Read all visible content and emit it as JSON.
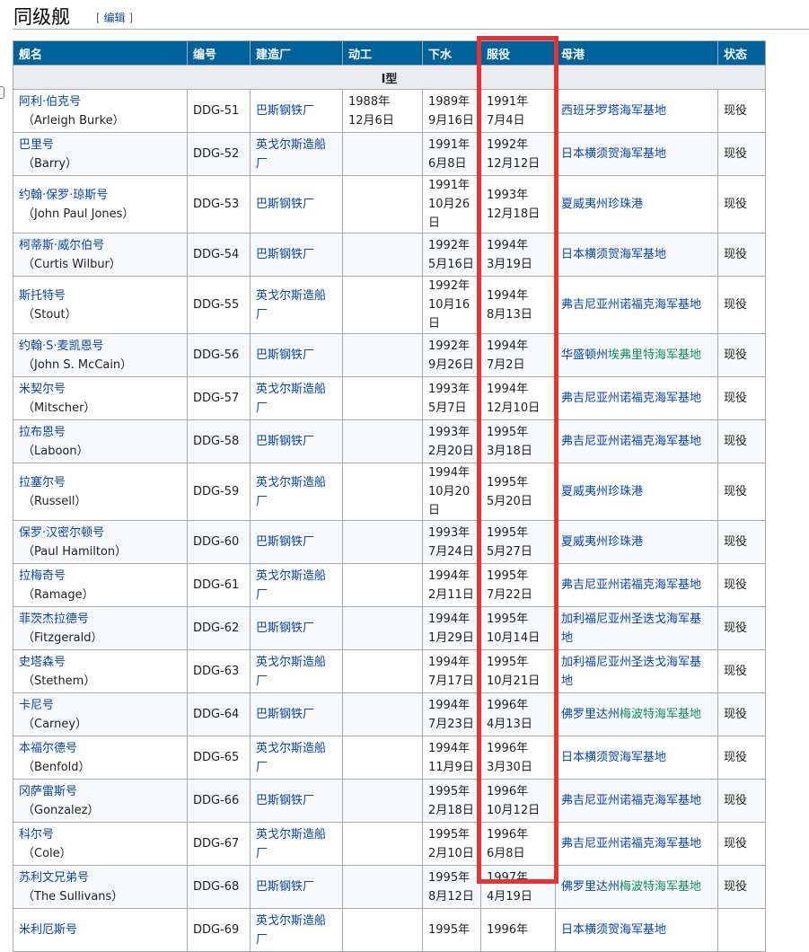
{
  "section": {
    "title": "同级舰",
    "edit_open": "[ ",
    "edit_label": "编辑",
    "edit_close": " ]"
  },
  "table": {
    "columns": [
      "舰名",
      "编号",
      "建造厂",
      "动工",
      "下水",
      "服役",
      "母港",
      "状态"
    ],
    "subheader": "I型",
    "rows": [
      {
        "cn": "阿利·伯克号",
        "en": "（Arleigh Burke）",
        "no": "DDG-51",
        "yard": "巴斯钢铁厂",
        "laid_y": "1988年",
        "laid_d": "12月6日",
        "launch_y": "1989年",
        "launch_d": "9月16日",
        "comm_y": "1991年",
        "comm_d": "7月4日",
        "port_a": "西班牙罗塔海军基地",
        "port_b": "",
        "status": "现役"
      },
      {
        "cn": "巴里号",
        "en": "（Barry）",
        "no": "DDG-52",
        "yard": "英戈尔斯造船厂",
        "laid_y": "",
        "laid_d": "",
        "launch_y": "1991年",
        "launch_d": "6月8日",
        "comm_y": "1992年",
        "comm_d": "12月12日",
        "port_a": "日本横须贺海军基地",
        "port_b": "",
        "status": "现役"
      },
      {
        "cn": "约翰·保罗·琼斯号",
        "en": "（John Paul Jones）",
        "no": "DDG-53",
        "yard": "巴斯钢铁厂",
        "laid_y": "",
        "laid_d": "",
        "launch_y": "1991年",
        "launch_d": "10月26日",
        "comm_y": "1993年",
        "comm_d": "12月18日",
        "port_a": "夏威夷州珍珠港",
        "port_b": "",
        "status": "现役"
      },
      {
        "cn": "柯蒂斯·威尔伯号",
        "en": "（Curtis Wilbur）",
        "no": "DDG-54",
        "yard": "巴斯钢铁厂",
        "laid_y": "",
        "laid_d": "",
        "launch_y": "1992年",
        "launch_d": "5月16日",
        "comm_y": "1994年",
        "comm_d": "3月19日",
        "port_a": "日本横须贺海军基地",
        "port_b": "",
        "status": "现役"
      },
      {
        "cn": "斯托特号",
        "en": "（Stout）",
        "no": "DDG-55",
        "yard": "英戈尔斯造船厂",
        "laid_y": "",
        "laid_d": "",
        "launch_y": "1992年",
        "launch_d": "10月16日",
        "comm_y": "1994年",
        "comm_d": "8月13日",
        "port_a": "弗吉尼亚州诺福克海军基地",
        "port_b": "",
        "status": "现役"
      },
      {
        "cn": "约翰·S·麦凯恩号",
        "en": "（John S. McCain）",
        "no": "DDG-56",
        "yard": "巴斯钢铁厂",
        "laid_y": "",
        "laid_d": "",
        "launch_y": "1992年",
        "launch_d": "9月26日",
        "comm_y": "1994年",
        "comm_d": "7月2日",
        "port_a": "华盛顿州",
        "port_b": "埃弗里特海军基地",
        "status": "现役"
      },
      {
        "cn": "米契尔号",
        "en": "（Mitscher）",
        "no": "DDG-57",
        "yard": "英戈尔斯造船厂",
        "laid_y": "",
        "laid_d": "",
        "launch_y": "1993年",
        "launch_d": "5月7日",
        "comm_y": "1994年",
        "comm_d": "12月10日",
        "port_a": "弗吉尼亚州诺福克海军基地",
        "port_b": "",
        "status": "现役"
      },
      {
        "cn": "拉布恩号",
        "en": "（Laboon）",
        "no": "DDG-58",
        "yard": "巴斯钢铁厂",
        "laid_y": "",
        "laid_d": "",
        "launch_y": "1993年",
        "launch_d": "2月20日",
        "comm_y": "1995年",
        "comm_d": "3月18日",
        "port_a": "弗吉尼亚州诺福克海军基地",
        "port_b": "",
        "status": "现役"
      },
      {
        "cn": "拉塞尔号",
        "en": "（Russell）",
        "no": "DDG-59",
        "yard": "英戈尔斯造船厂",
        "laid_y": "",
        "laid_d": "",
        "launch_y": "1994年",
        "launch_d": "10月20日",
        "comm_y": "1995年",
        "comm_d": "5月20日",
        "port_a": "夏威夷州珍珠港",
        "port_b": "",
        "status": "现役"
      },
      {
        "cn": "保罗·汉密尔顿号",
        "en": "（Paul Hamilton）",
        "no": "DDG-60",
        "yard": "巴斯钢铁厂",
        "laid_y": "",
        "laid_d": "",
        "launch_y": "1993年",
        "launch_d": "7月24日",
        "comm_y": "1995年",
        "comm_d": "5月27日",
        "port_a": "夏威夷州珍珠港",
        "port_b": "",
        "status": "现役"
      },
      {
        "cn": "拉梅奇号",
        "en": "（Ramage）",
        "no": "DDG-61",
        "yard": "英戈尔斯造船厂",
        "laid_y": "",
        "laid_d": "",
        "launch_y": "1994年",
        "launch_d": "2月11日",
        "comm_y": "1995年",
        "comm_d": "7月22日",
        "port_a": "弗吉尼亚州诺福克海军基地",
        "port_b": "",
        "status": "现役"
      },
      {
        "cn": "菲茨杰拉德号",
        "en": "（Fitzgerald）",
        "no": "DDG-62",
        "yard": "巴斯钢铁厂",
        "laid_y": "",
        "laid_d": "",
        "launch_y": "1994年",
        "launch_d": "1月29日",
        "comm_y": "1995年",
        "comm_d": "10月14日",
        "port_a": "加利福尼亚州圣迭戈海军基地",
        "port_b": "",
        "status": "现役"
      },
      {
        "cn": "史塔森号",
        "en": "（Stethem）",
        "no": "DDG-63",
        "yard": "英戈尔斯造船厂",
        "laid_y": "",
        "laid_d": "",
        "launch_y": "1994年",
        "launch_d": "7月17日",
        "comm_y": "1995年",
        "comm_d": "10月21日",
        "port_a": "加利福尼亚州圣迭戈海军基地",
        "port_b": "",
        "status": "现役"
      },
      {
        "cn": "卡尼号",
        "en": "（Carney）",
        "no": "DDG-64",
        "yard": "巴斯钢铁厂",
        "laid_y": "",
        "laid_d": "",
        "launch_y": "1994年",
        "launch_d": "7月23日",
        "comm_y": "1996年",
        "comm_d": "4月13日",
        "port_a": "佛罗里达州",
        "port_b": "梅波特海军基地",
        "status": "现役"
      },
      {
        "cn": "本福尔德号",
        "en": "（Benfold）",
        "no": "DDG-65",
        "yard": "英戈尔斯造船厂",
        "laid_y": "",
        "laid_d": "",
        "launch_y": "1994年",
        "launch_d": "11月9日",
        "comm_y": "1996年",
        "comm_d": "3月30日",
        "port_a": "日本横须贺海军基地",
        "port_b": "",
        "status": "现役"
      },
      {
        "cn": "冈萨雷斯号",
        "en": "（Gonzalez）",
        "no": "DDG-66",
        "yard": "巴斯钢铁厂",
        "laid_y": "",
        "laid_d": "",
        "launch_y": "1995年",
        "launch_d": "2月18日",
        "comm_y": "1996年",
        "comm_d": "10月12日",
        "port_a": "弗吉尼亚州诺福克海军基地",
        "port_b": "",
        "status": "现役"
      },
      {
        "cn": "科尔号",
        "en": "（Cole）",
        "no": "DDG-67",
        "yard": "英戈尔斯造船厂",
        "laid_y": "",
        "laid_d": "",
        "launch_y": "1995年",
        "launch_d": "2月10日",
        "comm_y": "1996年",
        "comm_d": "6月8日",
        "port_a": "弗吉尼亚州诺福克海军基地",
        "port_b": "",
        "status": "现役"
      },
      {
        "cn": "苏利文兄弟号",
        "en": "（The Sullivans）",
        "no": "DDG-68",
        "yard": "巴斯钢铁厂",
        "laid_y": "",
        "laid_d": "",
        "launch_y": "1995年",
        "launch_d": "8月12日",
        "comm_y": "1997年",
        "comm_d": "4月19日",
        "port_a": "佛罗里达州",
        "port_b": "梅波特海军基地",
        "status": "现役"
      },
      {
        "cn": "米利厄斯号",
        "en": "",
        "no": "DDG-69",
        "yard": "英戈尔斯造船厂",
        "laid_y": "",
        "laid_d": "",
        "launch_y": "1995年",
        "launch_d": "",
        "comm_y": "1996年",
        "comm_d": "",
        "port_a": "日本横须贺海军基地",
        "port_b": "",
        "status": ""
      }
    ]
  },
  "highlight": {
    "column": "服役",
    "color": "#e63434"
  }
}
